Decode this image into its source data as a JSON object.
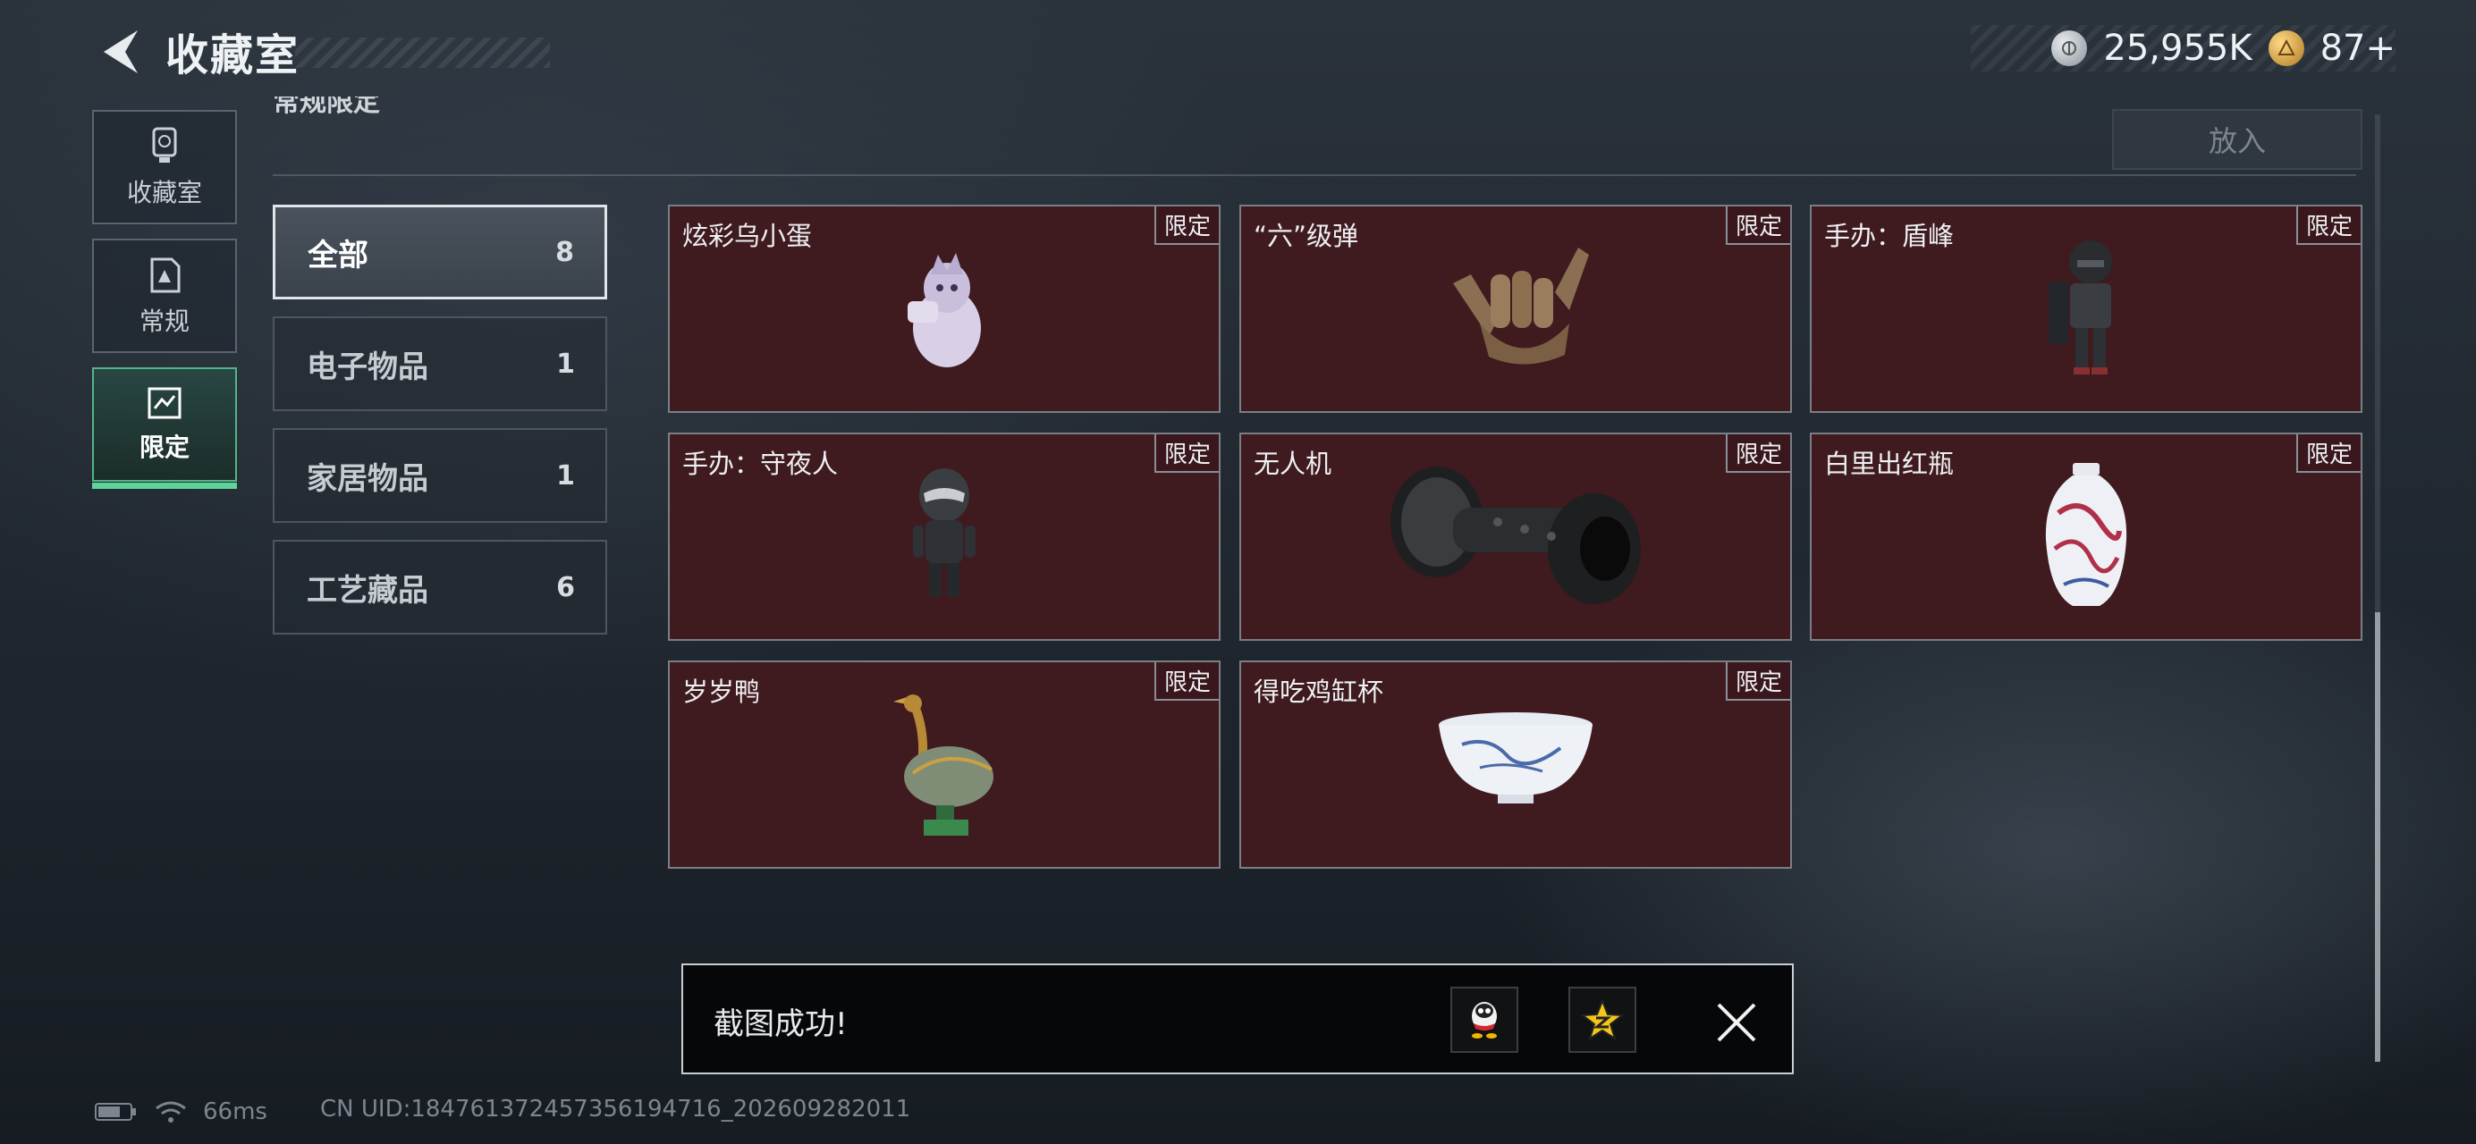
{
  "header": {
    "title": "收藏室",
    "currency": [
      {
        "icon": "silver-coin-icon",
        "value": "25,955K"
      },
      {
        "icon": "gold-coin-icon",
        "value": "87+"
      }
    ]
  },
  "left_nav": [
    {
      "label": "收藏室",
      "icon": "trophy-icon",
      "active": false
    },
    {
      "label": "常规",
      "icon": "document-icon",
      "active": false
    },
    {
      "label": "限定",
      "icon": "limited-icon",
      "active": true
    }
  ],
  "section": {
    "title": "常规限定",
    "put_in_label": "放入"
  },
  "categories": [
    {
      "name": "全部",
      "count": "8",
      "active": true
    },
    {
      "name": "电子物品",
      "count": "1",
      "active": false
    },
    {
      "name": "家居物品",
      "count": "1",
      "active": false
    },
    {
      "name": "工艺藏品",
      "count": "6",
      "active": false
    }
  ],
  "items": [
    {
      "name": "炫彩乌小蛋",
      "tag": "限定",
      "art": "egg-figurine-icon"
    },
    {
      "name": "“六”级弹",
      "tag": "限定",
      "art": "hand-sculpture-icon"
    },
    {
      "name": "手办：盾峰",
      "tag": "限定",
      "art": "armored-figure-icon"
    },
    {
      "name": "手办：守夜人",
      "tag": "限定",
      "art": "ninja-figure-icon"
    },
    {
      "name": "无人机",
      "tag": "限定",
      "art": "drone-icon"
    },
    {
      "name": "白里出红瓶",
      "tag": "限定",
      "art": "porcelain-vase-icon"
    },
    {
      "name": "岁岁鸭",
      "tag": "限定",
      "art": "bronze-duck-icon"
    },
    {
      "name": "得吃鸡缸杯",
      "tag": "限定",
      "art": "porcelain-cup-icon"
    }
  ],
  "toast": {
    "message": "截图成功!",
    "buttons": [
      "qq-share-icon",
      "qzone-share-icon",
      "close-icon"
    ]
  },
  "footer": {
    "ping": "66ms",
    "uid": "CN UID:184761372457356194716_202609282011"
  },
  "colors": {
    "accent_green": "#5ed39c",
    "card_bg": "#3f1a1f"
  }
}
